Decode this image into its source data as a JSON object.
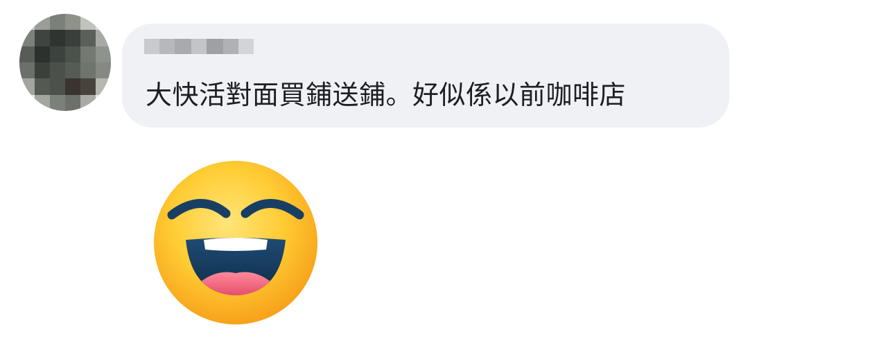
{
  "comment": {
    "text": "大快活對面買鋪送鋪。好似係以前咖啡店"
  },
  "avatar": {
    "icon": "blurred-avatar"
  },
  "author_name": {
    "icon": "blurred-name"
  },
  "sticker": {
    "icon": "laughing-face-emoji"
  }
}
